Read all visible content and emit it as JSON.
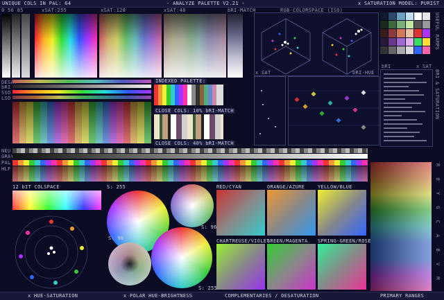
{
  "header": {
    "left": "UNIQUE COLS IN PAL: 64",
    "center": "- ANALYZE PALETTE V2.21 -",
    "right": "x SATURATION MODEL: PURIST"
  },
  "top_labels": {
    "lum": "0 50 85",
    "sat255": "xSAT:255",
    "sat128": "xSAT:128",
    "sat48": "xSAT:48",
    "brimatch": "bRI-MATCH",
    "rgb": "RGB-COLORSPACE (ISO)"
  },
  "side_labels": {
    "useful": "USEFUL RAMPS",
    "bri_sat": "BRI & SATURATION",
    "rainbow": "R O Y G C A B V M"
  },
  "left_labels": {
    "desat": "DESAT",
    "bri": "bRI",
    "sso": "SSO",
    "lso": "LSO",
    "neu": "NEU",
    "gray": "GRAY",
    "pal": "PAL",
    "hlf": "HLF"
  },
  "indexed": {
    "title": "INDEXED PALETTE:",
    "close10": "CLOSE COLS: 10% bRI-MATCH",
    "close40": "CLOSE COLS: 40% bRI-MATCH"
  },
  "mid_labels": {
    "xsat": "x SAT",
    "brihue": "bRI-HUE",
    "bri": "bRI",
    "xsat2": "x SAT"
  },
  "lower_labels": {
    "colspace12": "12 bIT COLSPACE",
    "s255a": "S: 255",
    "s96a": "S: 96",
    "s96b": "S: 96",
    "s255b": "S: 255",
    "red_cyan": "RED/CYAN",
    "orange_azure": "ORANGE/AZURE",
    "yellow_blue": "YELLOW/BLUE",
    "chart_violet": "CHARTREUSE/VIOLET",
    "green_magenta": "GREEN/MAGENTA",
    "spring_rose": "SPRING-GREEN/ROSE"
  },
  "footer": {
    "hue_sat": "x HUE-SATURATION",
    "polar": "x POLAR HUE-BRIGHTNESS",
    "comp": "COMPLEMENTARIES / DESATURATION",
    "primary": "PRIMARY RANGES"
  },
  "colors": {
    "background": "#0b0c24",
    "panel": "#0e0f2c",
    "text": "#cfd2e6",
    "accent": "#ffffff"
  }
}
